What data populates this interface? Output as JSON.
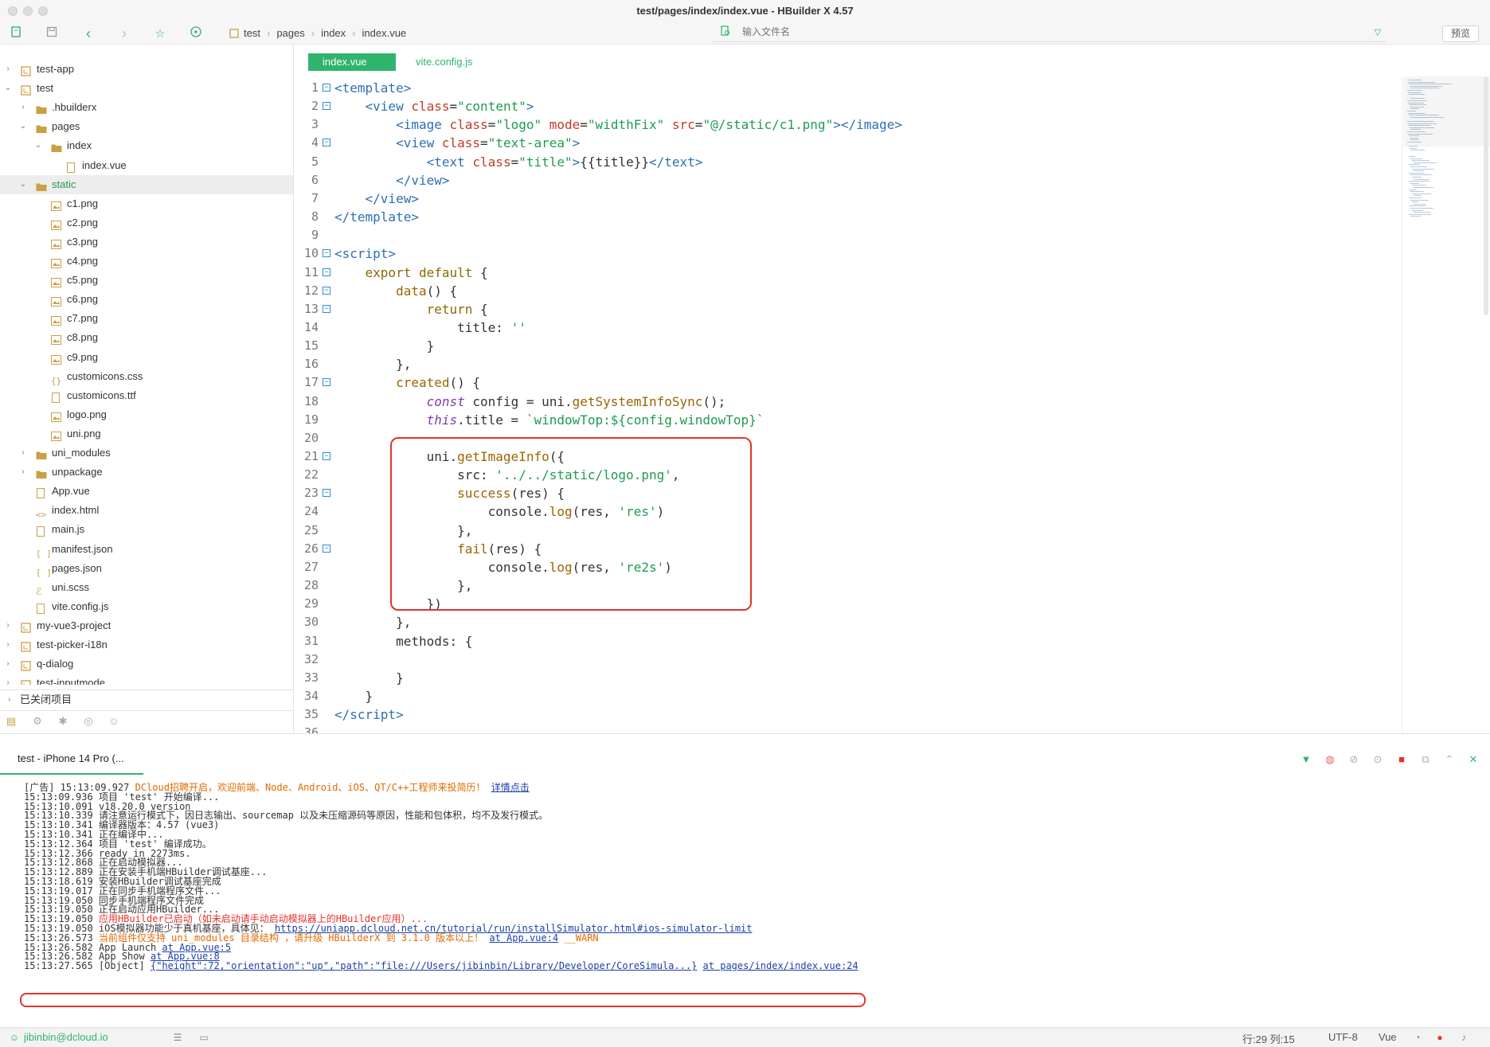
{
  "window": {
    "title": "test/pages/index/index.vue - HBuilder X 4.57"
  },
  "toolbar": {
    "breadcrumb": [
      "test",
      "pages",
      "index",
      "index.vue"
    ],
    "file_search_placeholder": "输入文件名",
    "preview_label": "预览"
  },
  "sidebar": {
    "tree": [
      {
        "label": "test-app",
        "type": "project",
        "level": 0,
        "arrow": "right"
      },
      {
        "label": "test",
        "type": "project",
        "level": 0,
        "arrow": "down"
      },
      {
        "label": ".hbuilderx",
        "type": "folder",
        "level": 1,
        "arrow": "right"
      },
      {
        "label": "pages",
        "type": "folder",
        "level": 1,
        "arrow": "down"
      },
      {
        "label": "index",
        "type": "folder",
        "level": 2,
        "arrow": "down"
      },
      {
        "label": "index.vue",
        "type": "file",
        "level": 3,
        "arrow": ""
      },
      {
        "label": "static",
        "type": "folder",
        "level": 1,
        "arrow": "down",
        "selected": true
      },
      {
        "label": "c1.png",
        "type": "image",
        "level": 2,
        "arrow": ""
      },
      {
        "label": "c2.png",
        "type": "image",
        "level": 2,
        "arrow": ""
      },
      {
        "label": "c3.png",
        "type": "image",
        "level": 2,
        "arrow": ""
      },
      {
        "label": "c4.png",
        "type": "image",
        "level": 2,
        "arrow": ""
      },
      {
        "label": "c5.png",
        "type": "image",
        "level": 2,
        "arrow": ""
      },
      {
        "label": "c6.png",
        "type": "image",
        "level": 2,
        "arrow": ""
      },
      {
        "label": "c7.png",
        "type": "image",
        "level": 2,
        "arrow": ""
      },
      {
        "label": "c8.png",
        "type": "image",
        "level": 2,
        "arrow": ""
      },
      {
        "label": "c9.png",
        "type": "image",
        "level": 2,
        "arrow": ""
      },
      {
        "label": "customicons.css",
        "type": "css",
        "level": 2,
        "arrow": ""
      },
      {
        "label": "customicons.ttf",
        "type": "file",
        "level": 2,
        "arrow": ""
      },
      {
        "label": "logo.png",
        "type": "image",
        "level": 2,
        "arrow": ""
      },
      {
        "label": "uni.png",
        "type": "image",
        "level": 2,
        "arrow": ""
      },
      {
        "label": "uni_modules",
        "type": "folder",
        "level": 1,
        "arrow": "right"
      },
      {
        "label": "unpackage",
        "type": "folder",
        "level": 1,
        "arrow": "right"
      },
      {
        "label": "App.vue",
        "type": "file",
        "level": 1,
        "arrow": ""
      },
      {
        "label": "index.html",
        "type": "html",
        "level": 1,
        "arrow": ""
      },
      {
        "label": "main.js",
        "type": "file",
        "level": 1,
        "arrow": ""
      },
      {
        "label": "manifest.json",
        "type": "json",
        "level": 1,
        "arrow": ""
      },
      {
        "label": "pages.json",
        "type": "json",
        "level": 1,
        "arrow": ""
      },
      {
        "label": "uni.scss",
        "type": "scss",
        "level": 1,
        "arrow": ""
      },
      {
        "label": "vite.config.js",
        "type": "file",
        "level": 1,
        "arrow": ""
      },
      {
        "label": "my-vue3-project",
        "type": "project",
        "level": 0,
        "arrow": "right"
      },
      {
        "label": "test-picker-i18n",
        "type": "project",
        "level": 0,
        "arrow": "right"
      },
      {
        "label": "q-dialog",
        "type": "project",
        "level": 0,
        "arrow": "right"
      },
      {
        "label": "test-inputmode",
        "type": "project",
        "level": 0,
        "arrow": "right"
      }
    ],
    "closed_projects": "已关闭项目"
  },
  "editor": {
    "tabs": [
      {
        "label": "index.vue",
        "active": true
      },
      {
        "label": "vite.config.js",
        "active": false
      }
    ],
    "lines": [
      {
        "n": "1",
        "fold": true,
        "html": "<span class=\"t-tag\">&lt;template&gt;</span>"
      },
      {
        "n": "2",
        "fold": true,
        "html": "    <span class=\"t-tag\">&lt;view</span> <span class=\"t-attr\">class</span>=<span class=\"t-str\">\"content\"</span><span class=\"t-tag\">&gt;</span>"
      },
      {
        "n": "3",
        "fold": false,
        "html": "        <span class=\"t-tag\">&lt;image</span> <span class=\"t-attr\">class</span>=<span class=\"t-str\">\"logo\"</span> <span class=\"t-attr\">mode</span>=<span class=\"t-str\">\"widthFix\"</span> <span class=\"t-attr\">src</span>=<span class=\"t-str\">\"@/static/c1.png\"</span><span class=\"t-tag\">&gt;&lt;/image&gt;</span>"
      },
      {
        "n": "4",
        "fold": true,
        "html": "        <span class=\"t-tag\">&lt;view</span> <span class=\"t-attr\">class</span>=<span class=\"t-str\">\"text-area\"</span><span class=\"t-tag\">&gt;</span>"
      },
      {
        "n": "5",
        "fold": false,
        "html": "            <span class=\"t-tag\">&lt;text</span> <span class=\"t-attr\">class</span>=<span class=\"t-str\">\"title\"</span><span class=\"t-tag\">&gt;</span>{{title}}<span class=\"t-tag\">&lt;/text&gt;</span>"
      },
      {
        "n": "6",
        "fold": false,
        "html": "        <span class=\"t-tag\">&lt;/view&gt;</span>"
      },
      {
        "n": "7",
        "fold": false,
        "html": "    <span class=\"t-tag\">&lt;/view&gt;</span>"
      },
      {
        "n": "8",
        "fold": false,
        "html": "<span class=\"t-tag\">&lt;/template&gt;</span>"
      },
      {
        "n": "9",
        "fold": false,
        "html": ""
      },
      {
        "n": "10",
        "fold": true,
        "html": "<span class=\"t-tag\">&lt;script&gt;</span>"
      },
      {
        "n": "11",
        "fold": true,
        "html": "    <span class=\"t-kw\">export default</span> {"
      },
      {
        "n": "12",
        "fold": true,
        "html": "        <span class=\"t-fn\">data</span>() {"
      },
      {
        "n": "13",
        "fold": true,
        "html": "            <span class=\"t-kw\">return</span> {"
      },
      {
        "n": "14",
        "fold": false,
        "html": "                title: <span class=\"t-str\">''</span>"
      },
      {
        "n": "15",
        "fold": false,
        "html": "            }"
      },
      {
        "n": "16",
        "fold": false,
        "html": "        },"
      },
      {
        "n": "17",
        "fold": true,
        "html": "        <span class=\"t-fn\">created</span>() {"
      },
      {
        "n": "18",
        "fold": false,
        "html": "            <span class=\"t-kw2\">const</span> config = uni.<span class=\"t-fn\">getSystemInfoSync</span>();"
      },
      {
        "n": "19",
        "fold": false,
        "html": "            <span class=\"t-kw2\">this</span>.title = <span class=\"t-str\">`windowTop:${config.windowTop}`</span>"
      },
      {
        "n": "20",
        "fold": false,
        "html": ""
      },
      {
        "n": "21",
        "fold": true,
        "html": "            uni.<span class=\"t-fn\">getImageInfo</span>({"
      },
      {
        "n": "22",
        "fold": false,
        "html": "                src: <span class=\"t-str\">'../../static/logo.png'</span>,"
      },
      {
        "n": "23",
        "fold": true,
        "html": "                <span class=\"t-fn\">success</span>(res) {"
      },
      {
        "n": "24",
        "fold": false,
        "html": "                    console.<span class=\"t-fn\">log</span>(res, <span class=\"t-str\">'res'</span>)"
      },
      {
        "n": "25",
        "fold": false,
        "html": "                },"
      },
      {
        "n": "26",
        "fold": true,
        "html": "                <span class=\"t-fn\">fail</span>(res) {"
      },
      {
        "n": "27",
        "fold": false,
        "html": "                    console.<span class=\"t-fn\">log</span>(res, <span class=\"t-str\">'re2s'</span>)"
      },
      {
        "n": "28",
        "fold": false,
        "html": "                },"
      },
      {
        "n": "29",
        "fold": false,
        "html": "            })"
      },
      {
        "n": "30",
        "fold": false,
        "html": "        },"
      },
      {
        "n": "31",
        "fold": false,
        "html": "        methods: {"
      },
      {
        "n": "32",
        "fold": false,
        "html": ""
      },
      {
        "n": "33",
        "fold": false,
        "html": "        }"
      },
      {
        "n": "34",
        "fold": false,
        "html": "    }"
      },
      {
        "n": "35",
        "fold": false,
        "html": "<span class=\"t-tag\">&lt;/script&gt;</span>"
      },
      {
        "n": "36",
        "fold": false,
        "html": ""
      }
    ]
  },
  "console": {
    "tab_label": "test - iPhone 14 Pro (...",
    "logs": [
      {
        "ts": "[广告] 15:13:09.927",
        "body": "DCloud招聘开启，欢迎前端、Node、Android、iOS、QT/C++工程师来投简历！",
        "link": "详情点击",
        "kind": "ad"
      },
      {
        "ts": "15:13:09.936",
        "body": "项目 'test' 开始编译...",
        "link": "",
        "kind": "normal"
      },
      {
        "ts": "15:13:10.091",
        "body": "v18.20.0 version",
        "link": "",
        "kind": "normal"
      },
      {
        "ts": "15:13:10.339",
        "body": "请注意运行模式下，因日志输出、sourcemap 以及未压缩源码等原因，性能和包体积，均不及发行模式。",
        "link": "",
        "kind": "normal"
      },
      {
        "ts": "15:13:10.341",
        "body": "编译器版本：4.57 (vue3)",
        "link": "",
        "kind": "normal"
      },
      {
        "ts": "15:13:10.341",
        "body": "正在编译中...",
        "link": "",
        "kind": "normal"
      },
      {
        "ts": "15:13:12.364",
        "body": "项目 'test' 编译成功。",
        "link": "",
        "kind": "normal"
      },
      {
        "ts": "15:13:12.366",
        "body": "ready in 2273ms.",
        "link": "",
        "kind": "normal"
      },
      {
        "ts": "15:13:12.868",
        "body": "正在启动模拟器...",
        "link": "",
        "kind": "normal"
      },
      {
        "ts": "15:13:12.889",
        "body": "正在安装手机端HBuilder调试基座...",
        "link": "",
        "kind": "normal"
      },
      {
        "ts": "15:13:18.619",
        "body": "安装HBuilder调试基座完成",
        "link": "",
        "kind": "normal"
      },
      {
        "ts": "15:13:19.017",
        "body": "正在同步手机端程序文件...",
        "link": "",
        "kind": "normal"
      },
      {
        "ts": "15:13:19.050",
        "body": "同步手机端程序文件完成",
        "link": "",
        "kind": "normal"
      },
      {
        "ts": "15:13:19.050",
        "body": "正在启动应用HBuilder...",
        "link": "",
        "kind": "normal"
      },
      {
        "ts": "15:13:19.050",
        "body": "应用HBuilder已启动（如未启动请手动启动模拟器上的HBuilder应用）...",
        "link": "",
        "kind": "err"
      },
      {
        "ts": "15:13:19.050",
        "body": "iOS模拟器功能少于真机基座，具体见：",
        "link": "https://uniapp.dcloud.net.cn/tutorial/run/installSimulator.html#ios-simulator-limit",
        "kind": "normal"
      },
      {
        "ts": "15:13:26.573",
        "body": "当前组件仅支持 uni_modules 目录结构 ，请升级 HBuilderX 到 3.1.0 版本以上！",
        "link": "at App.vue:4",
        "suffix": "__WARN",
        "kind": "warn"
      },
      {
        "ts": "15:13:26.582",
        "body": "App Launch",
        "link": "at App.vue:5",
        "kind": "normal"
      },
      {
        "ts": "15:13:26.582",
        "body": "App Show",
        "link": "at App.vue:8",
        "kind": "normal"
      },
      {
        "ts": "15:13:27.565",
        "body": "[Object]",
        "link": "{\"height\":72,\"orientation\":\"up\",\"path\":\"file:///Users/jibinbin/Library/Developer/CoreSimula...}",
        "link2": "at pages/index/index.vue:24",
        "kind": "normal"
      }
    ]
  },
  "statusbar": {
    "user": "jibinbin@dcloud.io",
    "position": "行:29  列:15",
    "encoding": "UTF-8",
    "language": "Vue"
  },
  "colors": {
    "accent": "#2fb46e",
    "highlight": "#e5322d",
    "link": "#1c3fa8"
  }
}
